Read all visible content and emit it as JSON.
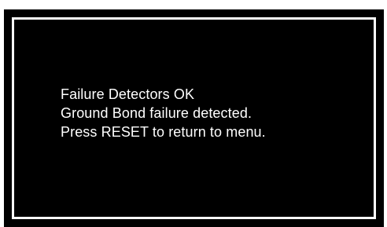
{
  "screen": {
    "colors": {
      "background": "#000000",
      "border": "#ffffff",
      "text": "#ffffff"
    },
    "messages": [
      "Failure Detectors OK",
      "Ground Bond failure detected.",
      "Press RESET to return to menu."
    ]
  }
}
